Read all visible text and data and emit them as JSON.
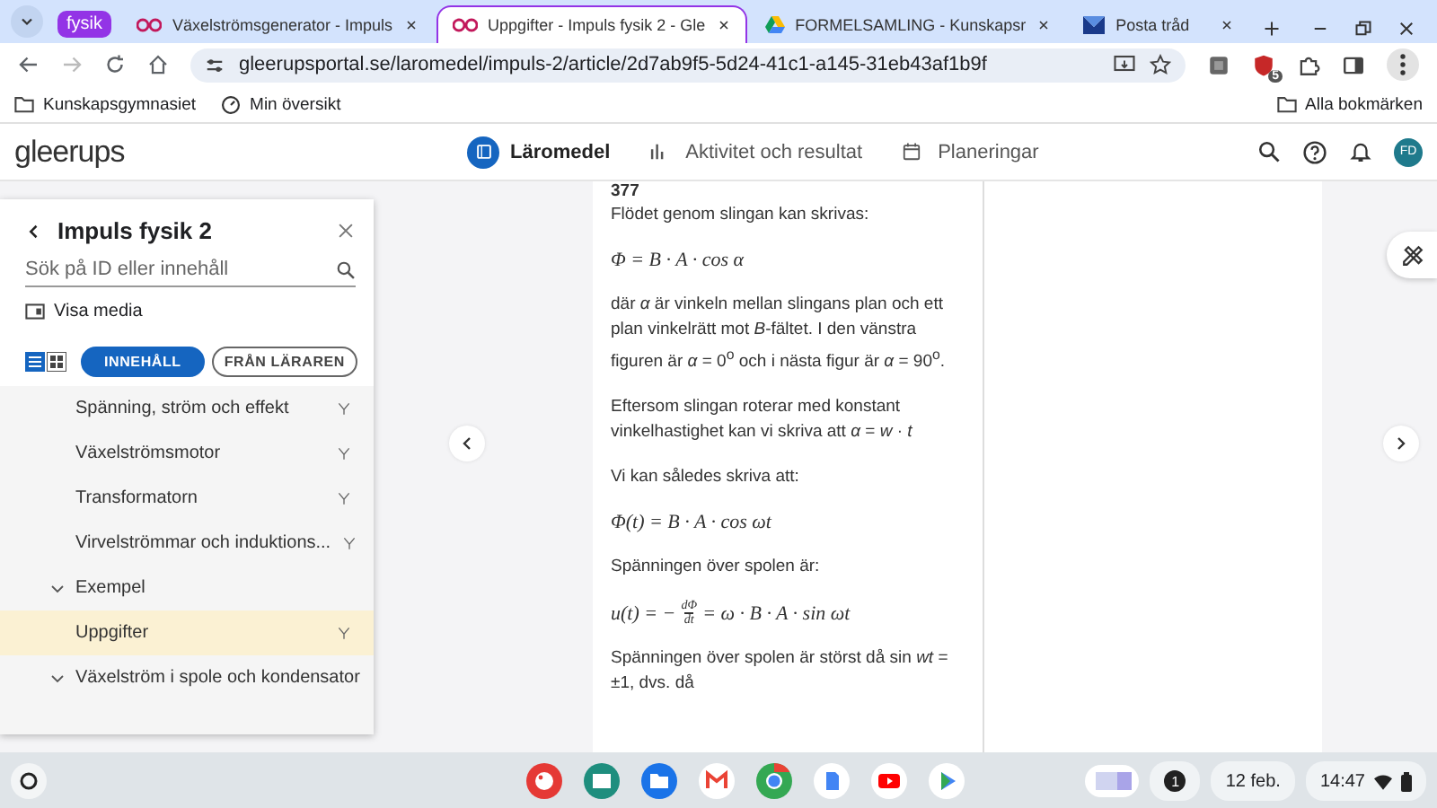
{
  "browser": {
    "tab_group": "fysik",
    "tabs": [
      {
        "title": "Växelströmsgenerator - Impuls",
        "selected": false,
        "kind": "ee"
      },
      {
        "title": "Uppgifter - Impuls fysik 2 - Gle",
        "selected": true,
        "kind": "ee"
      },
      {
        "title": "FORMELSAMLING - Kunskapsr",
        "selected": false,
        "kind": "drive"
      },
      {
        "title": "Posta tråd",
        "selected": false,
        "kind": "forum"
      }
    ],
    "url": "gleerupsportal.se/laromedel/impuls-2/article/2d7ab9f5-5d24-41c1-a145-31eb43af1b9f",
    "extension_badge": "5",
    "bookmarks": [
      "Kunskapsgymnasiet",
      "Min översikt"
    ],
    "all_bookmarks": "Alla bokmärken"
  },
  "header": {
    "logo": "gleerups",
    "nav": [
      {
        "label": "Läromedel",
        "selected": true,
        "kind": "book"
      },
      {
        "label": "Aktivitet och resultat",
        "selected": false,
        "kind": "chart"
      },
      {
        "label": "Planeringar",
        "selected": false,
        "kind": "calendar"
      }
    ],
    "avatar": "FD"
  },
  "sidebar": {
    "title": "Impuls fysik 2",
    "search": {
      "placeholder": "Sök på ID eller innehåll"
    },
    "media": "Visa media",
    "list_view": true,
    "filters": [
      {
        "label": "INNEHÅLL",
        "selected": true
      },
      {
        "label": "FRÅN LÄRAREN",
        "selected": false
      }
    ],
    "items": [
      {
        "label": "Spänning, ström och effekt",
        "kind": "leaf",
        "selected": false
      },
      {
        "label": "Växelströmsmotor",
        "kind": "leaf",
        "selected": false
      },
      {
        "label": "Transformatorn",
        "kind": "leaf",
        "selected": false
      },
      {
        "label": "Virvelströmmar och induktions...",
        "kind": "leaf",
        "selected": false
      },
      {
        "label": "Exempel",
        "kind": "group",
        "selected": false
      },
      {
        "label": "Uppgifter",
        "kind": "leaf",
        "selected": true
      },
      {
        "label": "Växelström i spole och kondensator",
        "kind": "group",
        "selected": false
      }
    ]
  },
  "article": [
    {
      "kind": "number",
      "text": "377"
    },
    {
      "kind": "para",
      "text": "Flödet genom slingan kan skrivas:"
    },
    {
      "kind": "math",
      "parts": [
        {
          "kind": "text",
          "text": "Φ = B · A · cos α"
        }
      ]
    },
    {
      "kind": "para",
      "text": "där *α* är vinkeln mellan slingans plan och ett plan vinkelrätt mot *B*-fältet. I den vänstra figuren är *α* = 0$^{o}$ och i nästa figur är *α* = 90$^{o}$."
    },
    {
      "kind": "para",
      "text": "Eftersom slingan roterar med konstant vinkelhastighet kan vi skriva att *α* = *w* · *t*"
    },
    {
      "kind": "para",
      "text": "Vi kan således skriva att:"
    },
    {
      "kind": "math",
      "parts": [
        {
          "kind": "text",
          "text": "Φ(t) = B · A · cos ωt"
        }
      ]
    },
    {
      "kind": "para",
      "text": "Spänningen över spolen är:"
    },
    {
      "kind": "math",
      "parts": [
        {
          "kind": "text",
          "text": "u(t) = −"
        },
        {
          "kind": "frac",
          "num": "dΦ",
          "den": "dt"
        },
        {
          "kind": "text",
          "text": "= ω · B · A · sin ωt"
        }
      ]
    },
    {
      "kind": "para",
      "text": "Spänningen över spolen är störst då sin *wt* = ±1, dvs. då"
    }
  ],
  "taskbar": {
    "notifications": "1",
    "date": "12 feb.",
    "time": "14:47"
  }
}
